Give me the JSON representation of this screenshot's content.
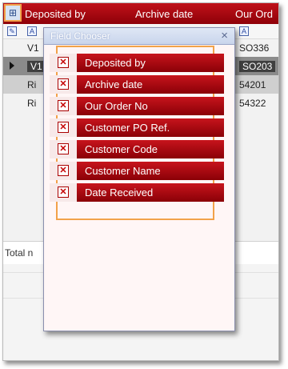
{
  "grid": {
    "chooser_icon": "field-chooser-icon",
    "columns": [
      "Deposited by",
      "Archive date",
      "Our Ord"
    ],
    "filter_icon_glyph": "A",
    "rows": [
      {
        "c1": "V1",
        "c3": "SO336"
      },
      {
        "c1": "V1",
        "c3": "SO203"
      },
      {
        "c1": "Ri",
        "c3": "54201"
      },
      {
        "c1": "Ri",
        "c3": "54322"
      }
    ],
    "total_label": "Total n"
  },
  "dialog": {
    "title": "Field Chooser",
    "close_glyph": "×",
    "check_glyph": "✕",
    "fields": [
      "Deposited by",
      "Archive date",
      "Our Order No",
      "Customer PO Ref.",
      "Customer Code",
      "Customer Name",
      "Date Received"
    ]
  },
  "colors": {
    "header_red": "#b3101a",
    "highlight_orange": "#f2a24a",
    "selected_row": "#3f3f3f"
  }
}
